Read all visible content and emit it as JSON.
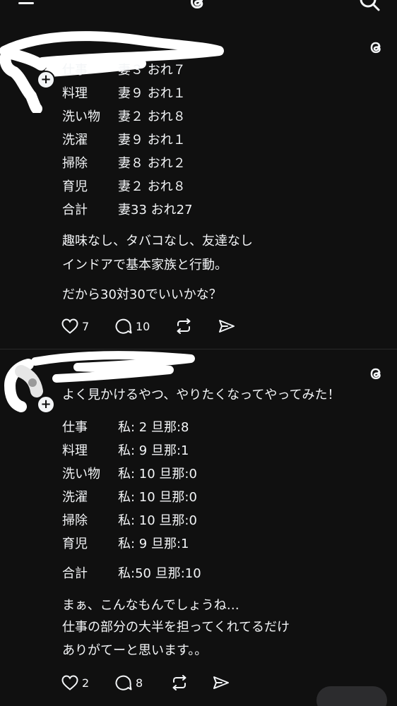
{
  "post1": {
    "rows": [
      {
        "label": "仕事",
        "value": "妻３ おれ７"
      },
      {
        "label": "料理",
        "value": "妻９ おれ１"
      },
      {
        "label": "洗い物",
        "value": "妻２ おれ８"
      },
      {
        "label": "洗濯",
        "value": "妻９ おれ１"
      },
      {
        "label": "掃除",
        "value": "妻８ おれ２"
      },
      {
        "label": "育児",
        "value": "妻２ おれ８"
      },
      {
        "label": "合計",
        "value": "妻33 おれ27"
      }
    ],
    "para1": "趣味なし、タバコなし、友達なし",
    "para2": "インドアで基本家族と行動。",
    "para3": "だから30対30でいいかな？",
    "likes": "7",
    "replies": "10"
  },
  "post2": {
    "intro": "よく見かけるやつ、やりたくなってやってみた！",
    "rows": [
      {
        "label": "仕事",
        "value": "私: 2 旦那:8"
      },
      {
        "label": "料理",
        "value": "私: 9 旦那:1"
      },
      {
        "label": "洗い物",
        "value": "私: 10 旦那:0"
      },
      {
        "label": "洗濯",
        "value": "私: 10 旦那:0"
      },
      {
        "label": "掃除",
        "value": "私: 10 旦那:0"
      },
      {
        "label": "育児",
        "value": "私: 9 旦那:1"
      }
    ],
    "total": {
      "label": "合計",
      "value": "私:50 旦那:10"
    },
    "para1": "まぁ、こんなもんでしょうね…",
    "para2": "仕事の部分の大半を担ってくれてるだけ",
    "para3": "ありがてーと思います。。",
    "likes": "2",
    "replies": "8"
  },
  "icons": {
    "like": "heart-icon",
    "reply": "comment-icon",
    "repost": "repost-icon",
    "share": "send-icon",
    "brand": "threads-logo-icon"
  },
  "colors": {
    "background": "#101010",
    "text": "#f3f5f7",
    "divider": "#2a2a2a"
  }
}
